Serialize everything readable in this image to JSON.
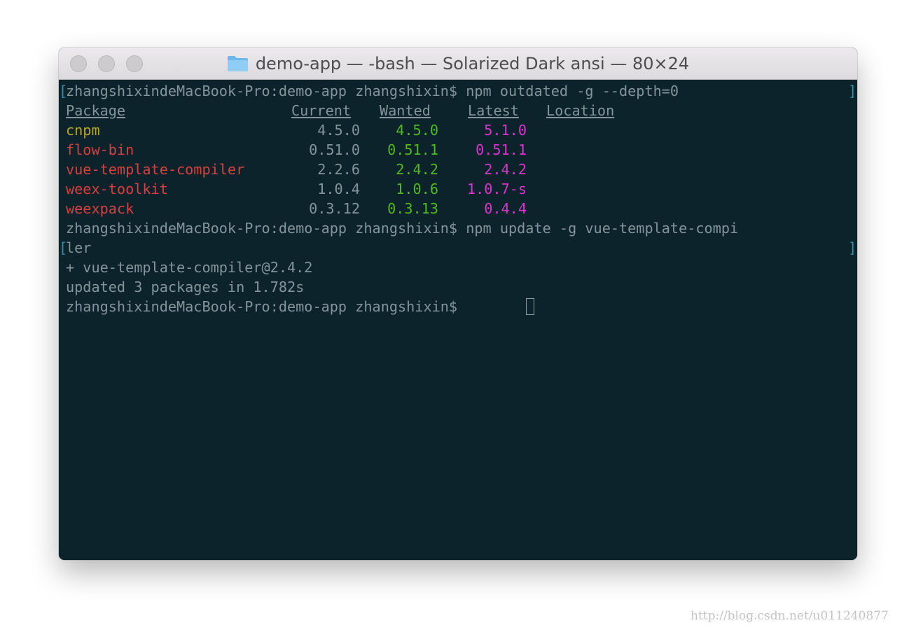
{
  "window": {
    "title": "demo-app — -bash — Solarized Dark ansi — 80×24",
    "folder_icon": "folder-icon",
    "colors": {
      "background": "#0c232b",
      "foreground": "#83949a",
      "yellow": "#b7a529",
      "red": "#d6413f",
      "green": "#4fb91d",
      "magenta": "#db33cf",
      "bracket": "#2f8fab"
    }
  },
  "terminal": {
    "line1": {
      "left_bracket": "[",
      "prompt": "zhangshixindeMacBook-Pro:demo-app zhangshixin$ npm outdated -g --depth=0",
      "right_bracket": "]"
    },
    "table": {
      "headers": {
        "package": "Package",
        "current": "Current",
        "wanted": "Wanted",
        "latest": "Latest",
        "location": "Location"
      },
      "rows": [
        {
          "package": "cnpm",
          "current": "4.5.0",
          "wanted": "4.5.0",
          "latest": "5.1.0"
        },
        {
          "package": "flow-bin",
          "current": "0.51.0",
          "wanted": "0.51.1",
          "latest": "0.51.1"
        },
        {
          "package": "vue-template-compiler",
          "current": "2.2.6",
          "wanted": "2.4.2",
          "latest": "2.4.2"
        },
        {
          "package": "weex-toolkit",
          "current": "1.0.4",
          "wanted": "1.0.6",
          "latest": "1.0.7-s"
        },
        {
          "package": "weexpack",
          "current": "0.3.12",
          "wanted": "0.3.13",
          "latest": "0.4.4"
        }
      ]
    },
    "line8": "zhangshixindeMacBook-Pro:demo-app zhangshixin$ npm update -g vue-template-compi",
    "line9": {
      "left_bracket": "[",
      "text": "ler",
      "right_bracket": "]"
    },
    "line10": "+ vue-template-compiler@2.4.2",
    "line11": "updated 3 packages in 1.782s",
    "line12": "zhangshixindeMacBook-Pro:demo-app zhangshixin$"
  },
  "watermark": "http://blog.csdn.net/u011240877"
}
